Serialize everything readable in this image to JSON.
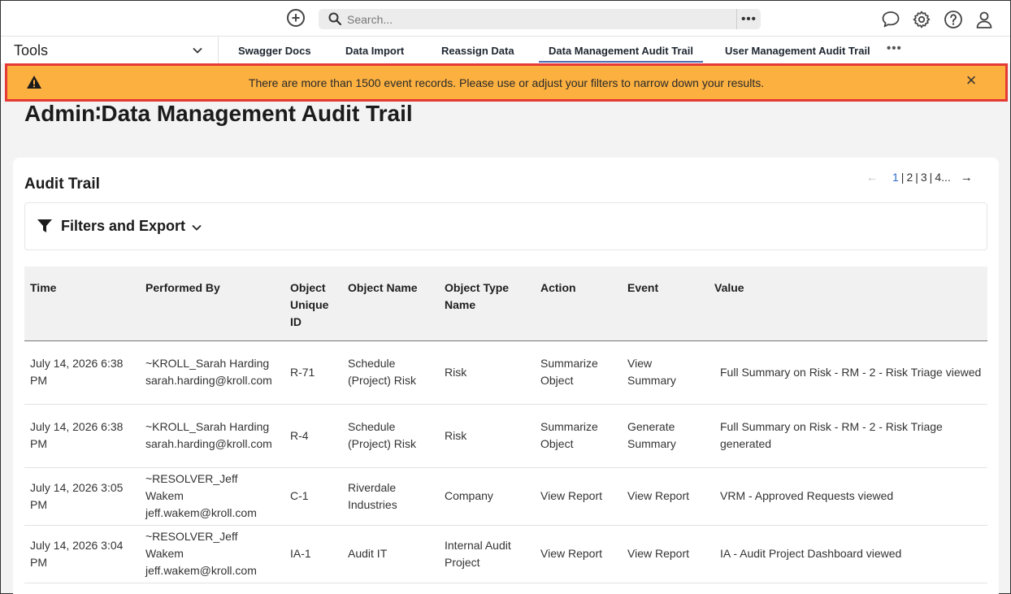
{
  "topbar": {
    "search_placeholder": "Search...",
    "search_more": "•••",
    "icons": [
      "add-circle-icon",
      "search-icon",
      "more-icon",
      "chat-icon",
      "gear-icon",
      "help-icon",
      "user-icon"
    ]
  },
  "nav": {
    "tools_label": "Tools",
    "tabs": [
      {
        "label": "Swagger Docs"
      },
      {
        "label": "Data Import"
      },
      {
        "label": "Reassign Data"
      },
      {
        "label": "Data Management Audit Trail",
        "active": true
      },
      {
        "label": "User Management Audit Trail"
      }
    ],
    "more": "•••"
  },
  "alert": {
    "message": "There are more than 1500 event records. Please use or adjust your filters to narrow down your results.",
    "close": "×",
    "background": "#fbb040",
    "highlight_border": "#e53935"
  },
  "page": {
    "title": "Admin∶Data Management Audit Trail"
  },
  "card": {
    "title": "Audit Trail",
    "pager": {
      "prev": "←",
      "pages": [
        "1",
        "2",
        "3",
        "4"
      ],
      "ellipsis": "...",
      "next": "→",
      "current": "1"
    },
    "filters_label": "Filters and Export"
  },
  "table": {
    "headers": [
      "Time",
      "Performed By",
      "Object Unique ID",
      "Object Name",
      "Object Type Name",
      "Action",
      "Event",
      "Value"
    ],
    "rows": [
      {
        "time": "July 14, 2026 6:38 PM",
        "performed_by_name": "~KROLL_Sarah Harding",
        "performed_by_email": "sarah.harding@kroll.com",
        "object_id": "R-71",
        "object_name": "Schedule (Project) Risk",
        "object_type": "Risk",
        "action": "Summarize Object",
        "event": "View Summary",
        "value": "Full Summary on Risk - RM - 2 - Risk Triage viewed"
      },
      {
        "time": "July 14, 2026 6:38 PM",
        "performed_by_name": "~KROLL_Sarah Harding",
        "performed_by_email": "sarah.harding@kroll.com",
        "object_id": "R-4",
        "object_name": "Schedule (Project) Risk",
        "object_type": "Risk",
        "action": "Summarize Object",
        "event": "Generate Summary",
        "value": "Full Summary on Risk - RM - 2 - Risk Triage generated"
      },
      {
        "time": "July 14, 2026 3:05 PM",
        "performed_by_name": "~RESOLVER_Jeff Wakem",
        "performed_by_email": "jeff.wakem@kroll.com",
        "object_id": "C-1",
        "object_name": "Riverdale Industries",
        "object_type": "Company",
        "action": "View Report",
        "event": "View Report",
        "value": "VRM - Approved Requests viewed"
      },
      {
        "time": "July 14, 2026 3:04 PM",
        "performed_by_name": "~RESOLVER_Jeff Wakem",
        "performed_by_email": "jeff.wakem@kroll.com",
        "object_id": "IA-1",
        "object_name": "Audit IT",
        "object_type": "Internal Audit Project",
        "action": "View Report",
        "event": "View Report",
        "value": "IA - Audit Project Dashboard viewed"
      }
    ]
  }
}
